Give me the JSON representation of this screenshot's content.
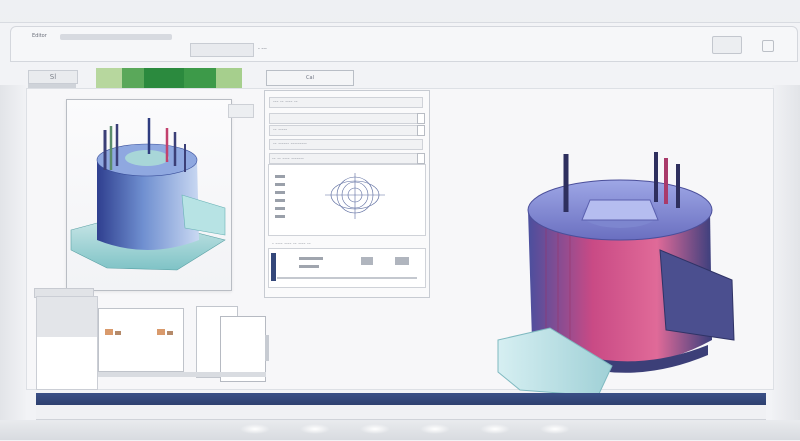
{
  "window": {
    "title": "Editor",
    "menu_hint": "- ----- --- ---- -----",
    "field_value": "",
    "button_label": "- ---"
  },
  "toolbar": {
    "label": "Sl",
    "button_label": "Cal",
    "swatches": [
      "#b7d79e",
      "#5aa85a",
      "#2b8a3e",
      "#3d9a49",
      "#a6cf8d"
    ]
  },
  "properties": {
    "row1": "--- -- ---- --",
    "row2": "-- -----",
    "section_title": "-- ------ ---------",
    "drawing_caption": "-- -- ---- -------",
    "table_caption": "- ---- ---- -- ---- --",
    "table_cols": [
      "--",
      "--",
      "--"
    ]
  },
  "status": {
    "left": "",
    "text": ""
  },
  "colors": {
    "accent": "#34477a",
    "model_shell_a": "#6f8fd0",
    "model_shell_b": "#d9557f",
    "model_base": "#a9d6d8"
  },
  "icons": [
    "close-icon",
    "minimize-icon",
    "scroll-icon"
  ]
}
